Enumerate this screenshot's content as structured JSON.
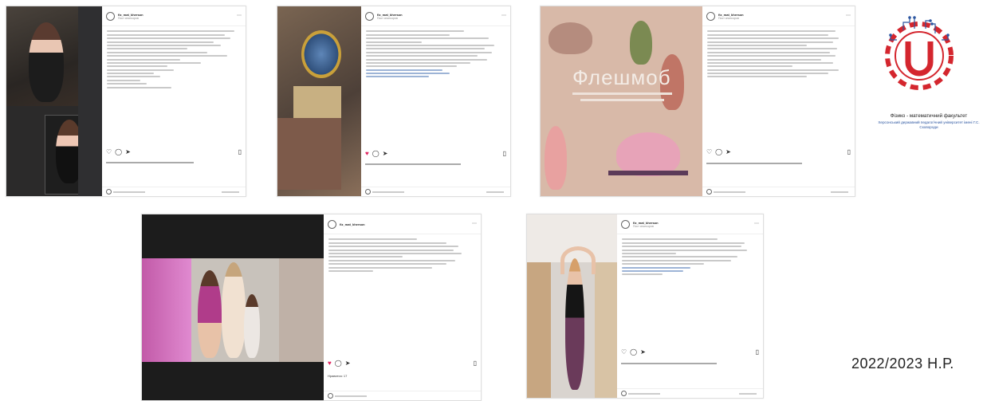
{
  "posts": [
    {
      "id": "post-1",
      "account": "fiz_mat_kherson",
      "subtitle": "Пост спонсоров",
      "liked": false
    },
    {
      "id": "post-2",
      "account": "fiz_mat_kherson",
      "subtitle": "Пост спонсоров",
      "liked": true
    },
    {
      "id": "post-3",
      "account": "fiz_mat_kherson",
      "subtitle": "Пост спонсоров",
      "liked": false,
      "poster_title": "Флешмоб"
    },
    {
      "id": "post-4",
      "account": "fiz_mat_kherson",
      "subtitle": "",
      "liked": true,
      "likes_text": "Нравится: 17"
    },
    {
      "id": "post-5",
      "account": "fiz_mat_kherson",
      "subtitle": "Пост спонсоров",
      "liked": false
    }
  ],
  "logo": {
    "caption_main": "Фізико - математичний факультет",
    "caption_sub": "Херсонський державний педагогічний університет імені Г.С. Сковороди"
  },
  "year_label": "2022/2023 Н.Р.",
  "colors": {
    "heart": "#e0245e",
    "logo_blue": "#2b55a0",
    "logo_red": "#d4262e",
    "poster_bg": "#d8b9a8"
  }
}
